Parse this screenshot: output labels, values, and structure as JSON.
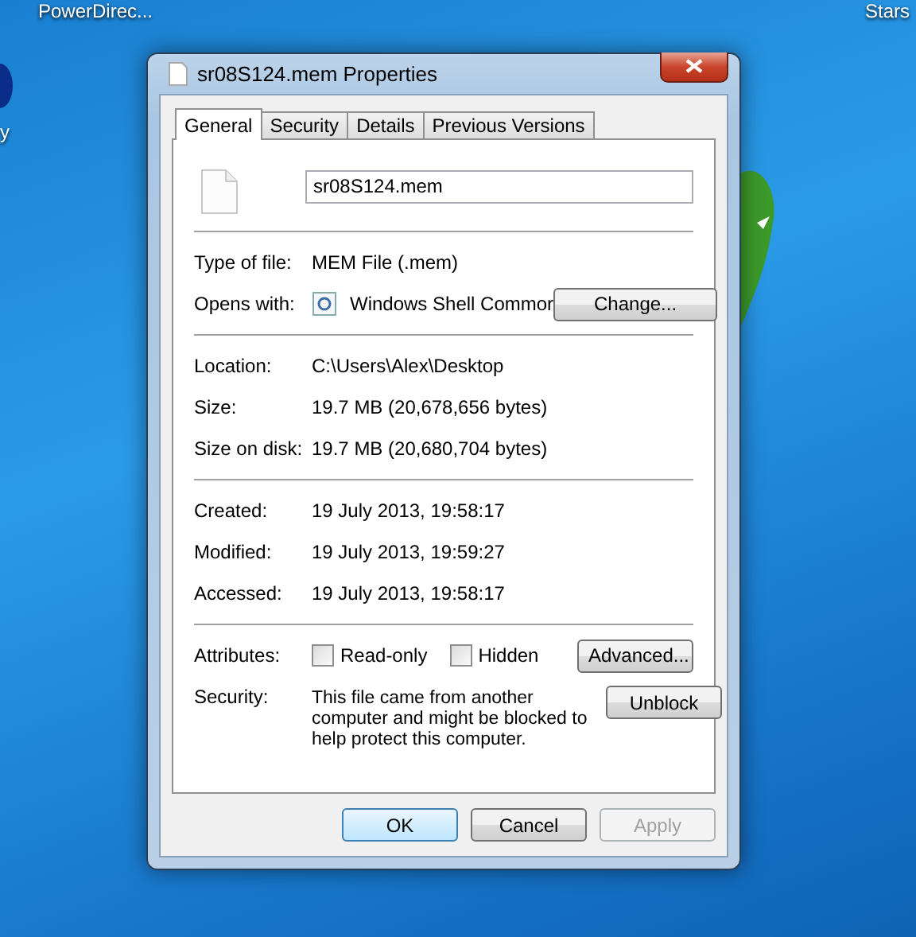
{
  "desktop": {
    "left_label": "y",
    "top_left_label": "PowerDirec...",
    "top_right_label": "Stars"
  },
  "window": {
    "title": "sr08S124.mem Properties"
  },
  "tabs": [
    {
      "label": "General",
      "selected": true
    },
    {
      "label": "Security",
      "selected": false
    },
    {
      "label": "Details",
      "selected": false
    },
    {
      "label": "Previous Versions",
      "selected": false
    }
  ],
  "file_name": {
    "value": "sr08S124.mem"
  },
  "sections": [
    [
      {
        "kind": "text",
        "label": "Type of file:",
        "value": "MEM File (.mem)"
      },
      {
        "kind": "app",
        "label": "Opens with:",
        "value": "Windows Shell Commor",
        "button": "Change..."
      }
    ],
    [
      {
        "kind": "text",
        "label": "Location:",
        "value": "C:\\Users\\Alex\\Desktop"
      },
      {
        "kind": "text",
        "label": "Size:",
        "value": "19.7 MB (20,678,656 bytes)"
      },
      {
        "kind": "text",
        "label": "Size on disk:",
        "value": "19.7 MB (20,680,704 bytes)"
      }
    ],
    [
      {
        "kind": "text",
        "label": "Created:",
        "value": "19 July 2013, 19:58:17"
      },
      {
        "kind": "text",
        "label": "Modified:",
        "value": "19 July 2013, 19:59:27"
      },
      {
        "kind": "text",
        "label": "Accessed:",
        "value": "19 July 2013, 19:58:17"
      }
    ],
    [
      {
        "kind": "checks",
        "label": "Attributes:",
        "checks": [
          {
            "label": "Read-only",
            "checked": false
          },
          {
            "label": "Hidden",
            "checked": false
          }
        ],
        "button": "Advanced..."
      },
      {
        "kind": "note",
        "label": "Security:",
        "value": "This file came from another computer and might be blocked to help protect this computer.",
        "button": "Unblock"
      }
    ]
  ],
  "buttons": [
    {
      "label": "OK",
      "default": true,
      "disabled": false
    },
    {
      "label": "Cancel",
      "default": false,
      "disabled": false
    },
    {
      "label": "Apply",
      "default": false,
      "disabled": true
    }
  ]
}
